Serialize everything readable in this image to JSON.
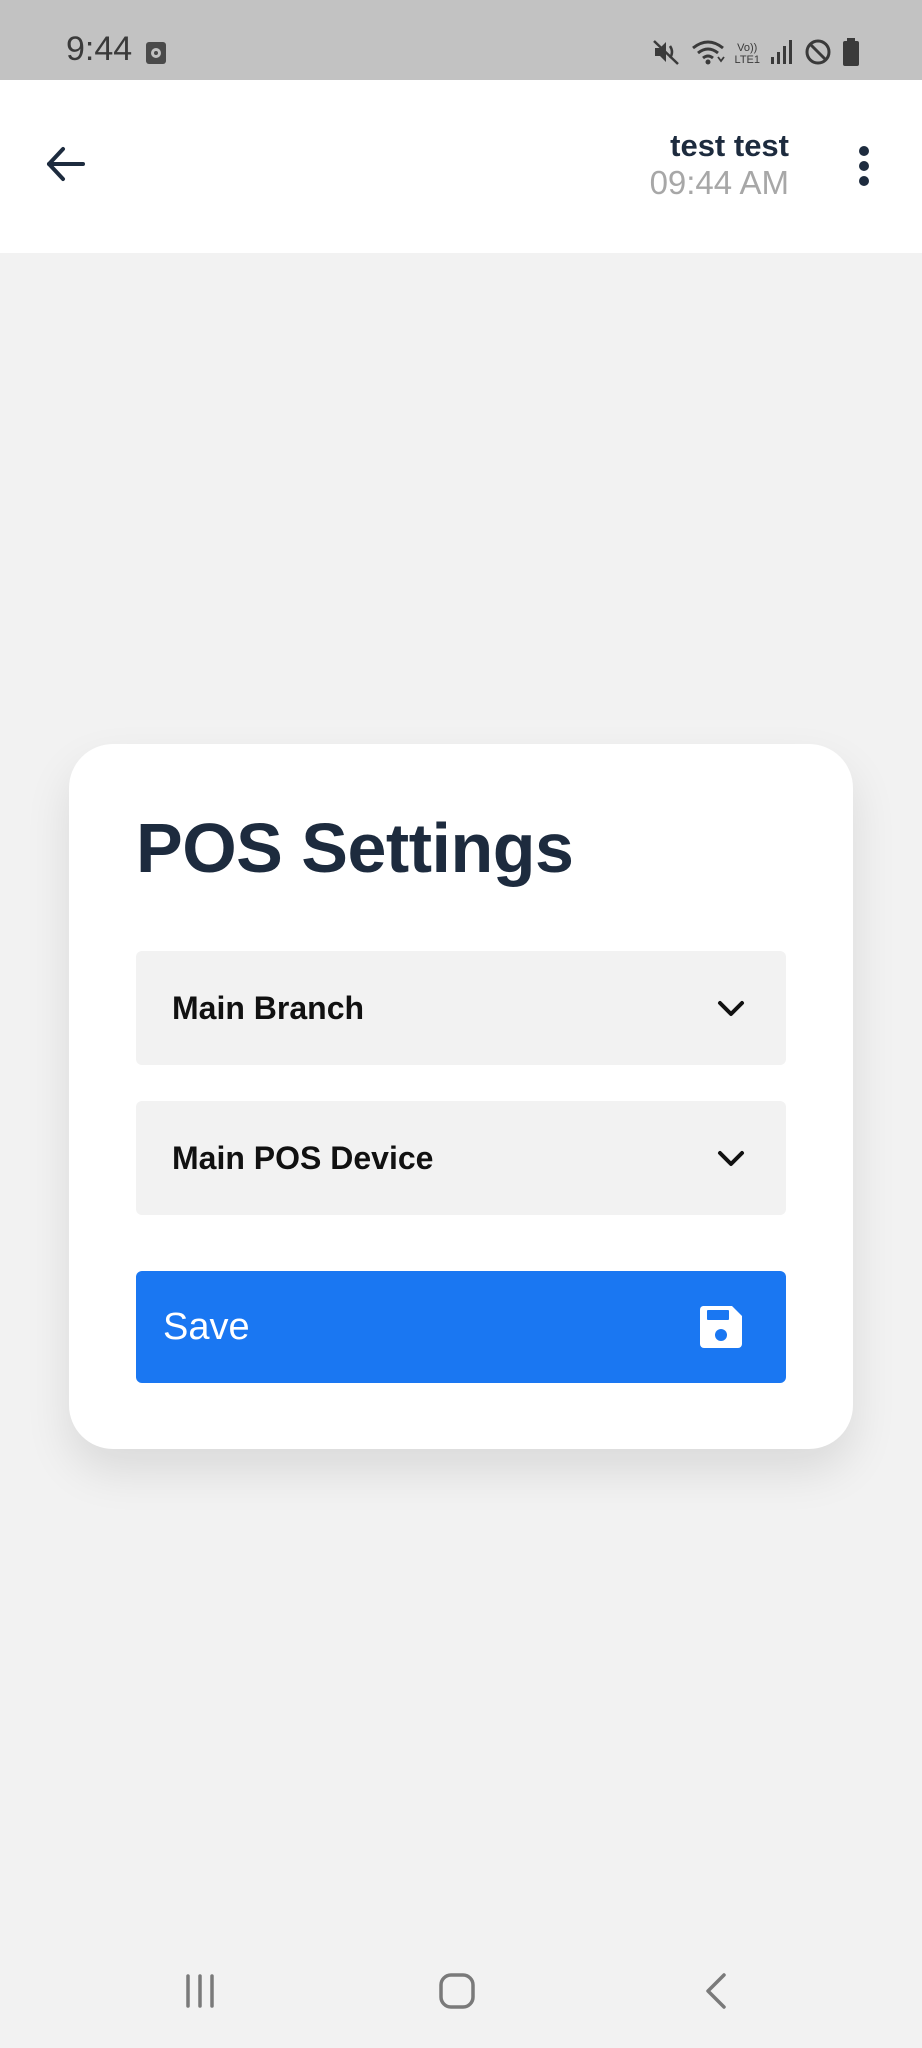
{
  "status_bar": {
    "time": "9:44",
    "network_top": "Vo))",
    "network_bottom": "LTE1"
  },
  "header": {
    "user_name": "test test",
    "time": "09:44 AM"
  },
  "card": {
    "title": "POS Settings",
    "branch_select": {
      "value": "Main Branch"
    },
    "device_select": {
      "value": "Main POS Device"
    },
    "save_label": "Save"
  },
  "colors": {
    "primary": "#1a77f2",
    "title_text": "#1d2b3e",
    "background": "#f2f2f2",
    "status_bar": "#c2c2c2"
  },
  "icons": {
    "back": "arrow-left-icon",
    "more": "more-vertical-icon",
    "dropdown": "chevron-down-icon",
    "save": "floppy-disk-icon"
  }
}
